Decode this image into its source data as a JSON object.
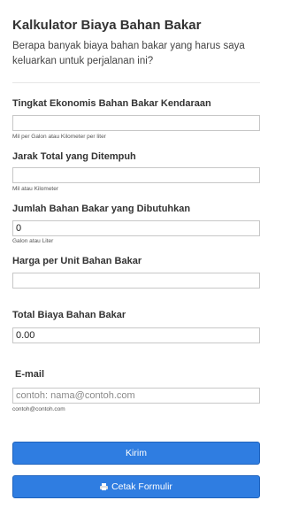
{
  "form": {
    "title": "Kalkulator Biaya Bahan Bakar",
    "subtitle": "Berapa banyak biaya bahan bakar yang harus saya keluarkan untuk perjalanan ini?"
  },
  "fields": {
    "economy": {
      "label": "Tingkat Ekonomis Bahan Bakar Kendaraan",
      "value": "",
      "hint": "Mil per Galon atau Kilometer per liter"
    },
    "distance": {
      "label": "Jarak Total yang Ditempuh",
      "value": "",
      "hint": "Mil atau Kilometer"
    },
    "fuel_needed": {
      "label": "Jumlah Bahan Bakar yang Dibutuhkan",
      "value": "0",
      "hint": "Galon atau Liter"
    },
    "price_per_unit": {
      "label": "Harga per Unit Bahan Bakar",
      "value": ""
    },
    "total_cost": {
      "label": "Total Biaya Bahan Bakar",
      "value": "0.00"
    },
    "email": {
      "label": "E-mail",
      "placeholder": "contoh: nama@contoh.com",
      "hint": "contoh@contoh.com"
    }
  },
  "buttons": {
    "submit_label": "Kirim",
    "print_label": "Cetak Formulir",
    "print_icon": "printer-icon"
  },
  "colors": {
    "button_blue": "#2f7de1"
  }
}
